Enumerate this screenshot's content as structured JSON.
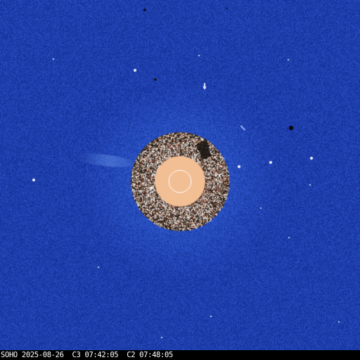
{
  "image": {
    "kind": "coronagraph-composite",
    "palette": {
      "sky": "#1e3fb0",
      "occulter_ring": "#3a2c22",
      "sun_disk": "#f2be94",
      "limb_circle": "#ffffff",
      "caption_bar": "#000000",
      "caption_text": "#ffffff"
    }
  },
  "caption": {
    "observatory": "SOHO",
    "date": "2025-08-26",
    "c3_label": "C3",
    "c3_time": "07:42:05",
    "c2_label": "C2",
    "c2_time": "07:48:05"
  }
}
